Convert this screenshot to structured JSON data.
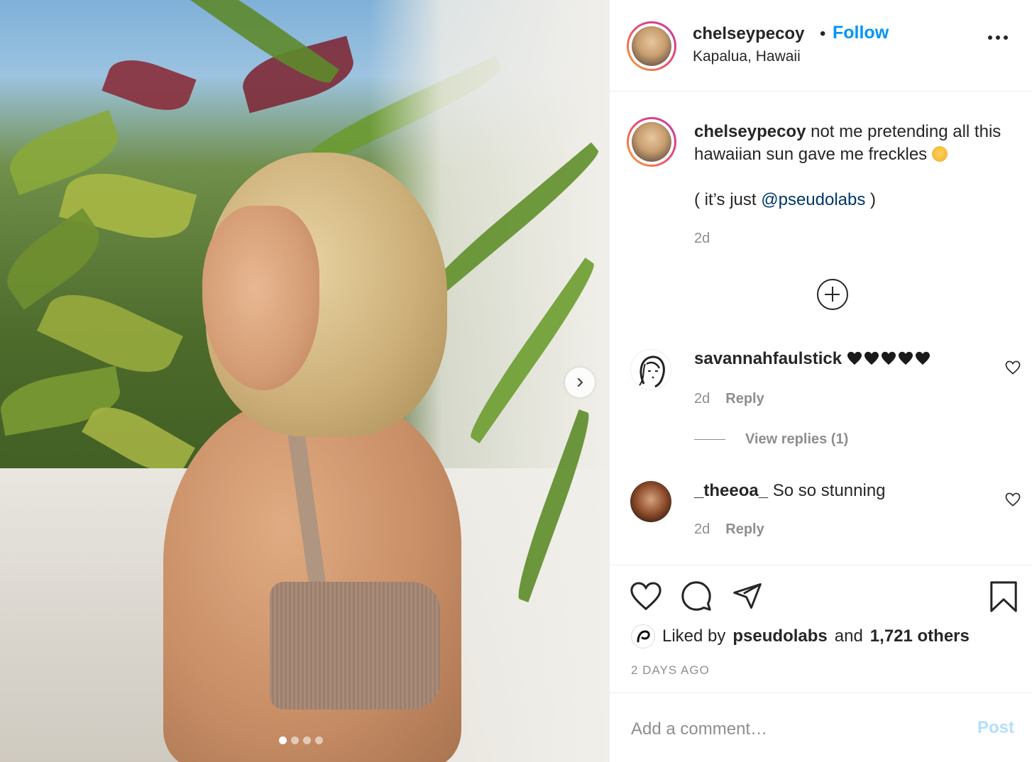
{
  "post": {
    "username": "chelseypecoy",
    "separator": "•",
    "follow_label": "Follow",
    "location": "Kapalua, Hawaii",
    "more_icon": "more-options-icon",
    "carousel": {
      "total_images": 4,
      "active_index": 0,
      "next_icon": "chevron-right-icon"
    }
  },
  "caption": {
    "username": "chelseypecoy",
    "text_part1": "not me pretending all this hawaiian sun gave me freckles",
    "emoji": "sun-face-emoji",
    "line2_prefix": "( it’s just ",
    "mention": "@pseudolabs",
    "line2_suffix": " )",
    "time": "2d"
  },
  "load_more_icon": "plus-circle-icon",
  "comments": [
    {
      "username": "savannahfaulstick",
      "hearts": [
        "black-heart-emoji",
        "black-heart-emoji",
        "black-heart-emoji",
        "black-heart-emoji",
        "black-heart-emoji"
      ],
      "time": "2d",
      "reply_label": "Reply",
      "view_replies": "View replies (1)"
    },
    {
      "username": "_theeoa_",
      "text": "So so stunning",
      "time": "2d",
      "reply_label": "Reply"
    }
  ],
  "actions": {
    "like_icon": "heart-icon",
    "comment_icon": "comment-icon",
    "share_icon": "paper-plane-icon",
    "save_icon": "bookmark-icon"
  },
  "likes": {
    "prefix": "Liked by",
    "liker": "pseudolabs",
    "middle": "and",
    "others": "1,721 others"
  },
  "date": "2 DAYS AGO",
  "comment_box": {
    "placeholder": "Add a comment…",
    "post_label": "Post"
  },
  "colors": {
    "link_blue": "#0095f6",
    "mention_blue": "#00376b",
    "post_disabled": "#b2dffc",
    "muted": "#8e8e8e",
    "text": "#262626"
  }
}
